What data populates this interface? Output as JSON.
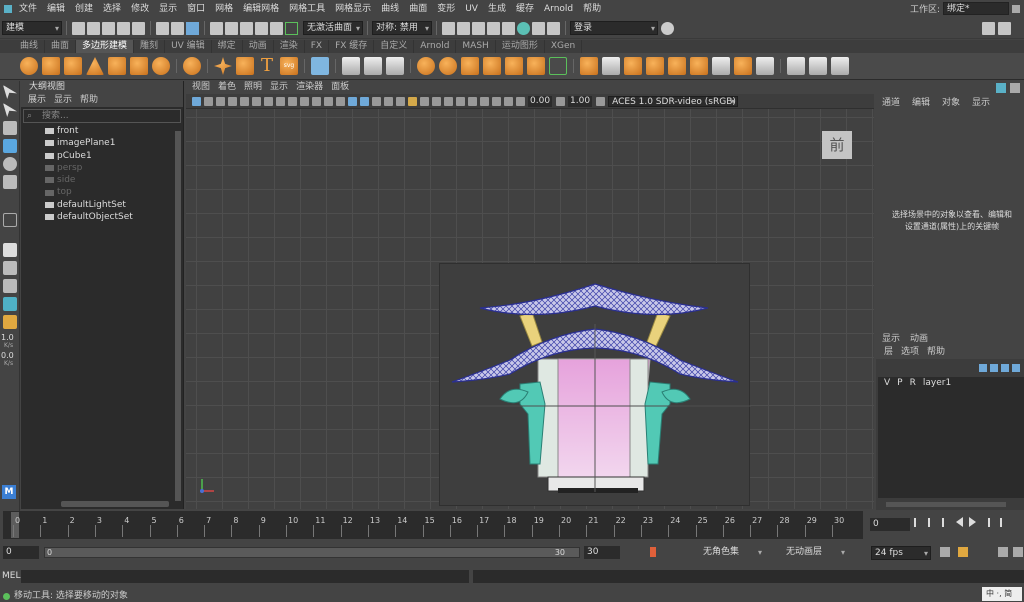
{
  "menubar": {
    "items": [
      "文件",
      "编辑",
      "创建",
      "选择",
      "修改",
      "显示",
      "窗口",
      "网格",
      "编辑网格",
      "网格工具",
      "网格显示",
      "曲线",
      "曲面",
      "变形",
      "UV",
      "生成",
      "缓存",
      "Arnold",
      "帮助"
    ],
    "workspace_label": "工作区:",
    "workspace_value": "绑定*"
  },
  "statusline": {
    "mode": "建模",
    "live_surface": "无激活曲面",
    "symmetry": "对称: 禁用",
    "login": "登录"
  },
  "shelf_tabs": [
    "曲线",
    "曲面",
    "多边形建模",
    "雕刻",
    "UV 编辑",
    "绑定",
    "动画",
    "渲染",
    "FX",
    "FX 缓存",
    "自定义",
    "Arnold",
    "MASH",
    "运动图形",
    "XGen"
  ],
  "shelf_active_tab": "多边形建模",
  "outliner": {
    "title": "大纲视图",
    "menu": [
      "展示",
      "显示",
      "帮助"
    ],
    "search_placeholder": "搜索...",
    "items": [
      {
        "label": "front",
        "dim": false
      },
      {
        "label": "imagePlane1",
        "dim": false
      },
      {
        "label": "pCube1",
        "dim": false
      },
      {
        "label": "persp",
        "dim": true
      },
      {
        "label": "side",
        "dim": true
      },
      {
        "label": "top",
        "dim": true
      },
      {
        "label": "defaultLightSet",
        "dim": false
      },
      {
        "label": "defaultObjectSet",
        "dim": false
      }
    ]
  },
  "viewport": {
    "menu": [
      "视图",
      "着色",
      "照明",
      "显示",
      "渲染器",
      "面板"
    ],
    "exposure": "0.00",
    "gamma": "1.00",
    "colorspace": "ACES 1.0 SDR-video (sRGB)",
    "view_label": "前"
  },
  "toolbox": {
    "val1": "1.0",
    "unit1": "K/s",
    "val2": "0.0",
    "unit2": "K/s"
  },
  "channelbox": {
    "tabs": [
      "通道",
      "编辑",
      "对象",
      "显示"
    ],
    "hint": "选择场景中的对象以查看、编辑和设置通道(属性)上的关键帧"
  },
  "layers": {
    "tabs": [
      "显示",
      "动画"
    ],
    "menu": [
      "层",
      "选项",
      "帮助"
    ],
    "v": "V",
    "p": "P",
    "r": "R",
    "layer_name": "layer1"
  },
  "timeslider": {
    "ticks": [
      "0",
      "1",
      "2",
      "3",
      "4",
      "5",
      "6",
      "7",
      "8",
      "9",
      "10",
      "11",
      "12",
      "13",
      "14",
      "15",
      "16",
      "17",
      "18",
      "19",
      "20",
      "21",
      "22",
      "23",
      "24",
      "25",
      "26",
      "27",
      "28",
      "29",
      "30"
    ],
    "current_frame": "0"
  },
  "range": {
    "start": "0",
    "inner_start": "0",
    "inner_end": "30",
    "end": "30",
    "character_set": "无角色集",
    "anim_layer": "无动画层",
    "fps": "24 fps"
  },
  "cmdline": {
    "label": "MEL"
  },
  "helpline": {
    "text": "移动工具: 选择要移动的对象"
  },
  "ime": {
    "text": "中 ·, 简"
  }
}
